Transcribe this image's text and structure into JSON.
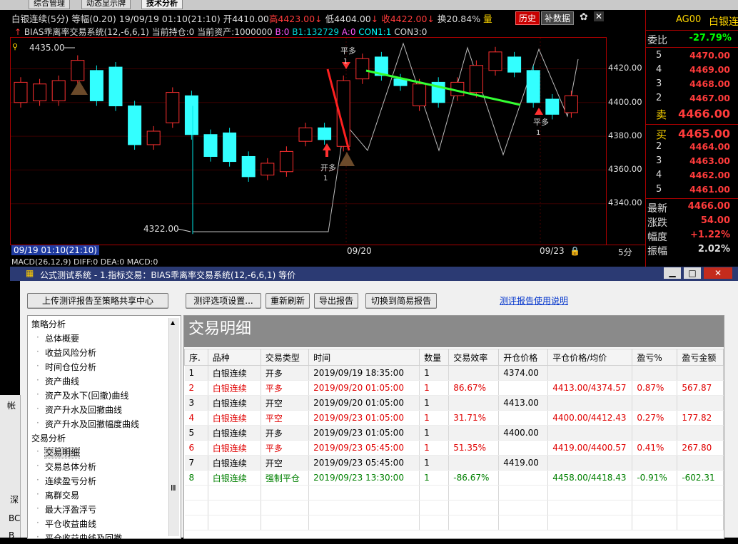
{
  "top_tabs": [
    "综合管理",
    "动态显示牌",
    "技术分析"
  ],
  "header": {
    "symbol": "白银连续(5分)",
    "equal_width": "等幅(0.20)",
    "datetime": "19/09/19 01:10(21:10)",
    "open": "开4410.00",
    "high": "高4423.00",
    "low": "低4404.00",
    "close": "收4422.00",
    "turnover": "换20.84%",
    "volume_prefix": "量",
    "history_btn": "历史",
    "supplement_btn": "补数据",
    "system_name": "BIAS乖离率交易系统(12,-6,6,1)",
    "position": "当前持仓:0",
    "assets": "当前资产:1000000",
    "b0": "B:0",
    "b1": "B1:132729",
    "a0": "A:0",
    "con1": "CON1:1",
    "con3": "CON3:0"
  },
  "chart_data": {
    "type": "candlestick",
    "y_ticks": [
      "4420.00",
      "4400.00",
      "4380.00",
      "4360.00",
      "4340.00"
    ],
    "ylim": [
      4320,
      4435
    ],
    "annotations": {
      "max_label": "4435.00",
      "min_label": "4322.00"
    },
    "x_labels": [
      "09/19 01:10(21:10)",
      "09/20",
      "09/23",
      "5分"
    ],
    "signals": [
      {
        "text": "开多",
        "sub": "1"
      },
      {
        "text": "平多",
        "sub": "1"
      },
      {
        "text": "平多",
        "sub": "1"
      }
    ],
    "candles": [
      {
        "o": 4400,
        "c": 4412
      },
      {
        "o": 4401,
        "c": 4411
      },
      {
        "o": 4401,
        "c": 4413
      },
      {
        "o": 4413,
        "c": 4425
      },
      {
        "o": 4419,
        "c": 4401
      },
      {
        "o": 4421,
        "c": 4398
      },
      {
        "o": 4398,
        "c": 4375
      },
      {
        "o": 4375,
        "c": 4383
      },
      {
        "o": 4388,
        "c": 4406
      },
      {
        "o": 4404,
        "c": 4381
      },
      {
        "o": 4381,
        "c": 4368
      },
      {
        "o": 4382,
        "c": 4365
      },
      {
        "o": 4368,
        "c": 4356
      },
      {
        "o": 4357,
        "c": 4364
      },
      {
        "o": 4359,
        "c": 4371
      },
      {
        "o": 4377,
        "c": 4385
      },
      {
        "o": 4385,
        "c": 4378
      },
      {
        "o": 4374,
        "c": 4413
      },
      {
        "o": 4414,
        "c": 4426
      },
      {
        "o": 4427,
        "c": 4416
      },
      {
        "o": 4414,
        "c": 4410
      },
      {
        "o": 4398,
        "c": 4411
      },
      {
        "o": 4412,
        "c": 4400
      },
      {
        "o": 4404,
        "c": 4412
      },
      {
        "o": 4406,
        "c": 4422
      },
      {
        "o": 4419,
        "c": 4430
      },
      {
        "o": 4427,
        "c": 4418
      },
      {
        "o": 4419,
        "c": 4400
      },
      {
        "o": 4402,
        "c": 4393
      },
      {
        "o": 4394,
        "c": 4404
      }
    ]
  },
  "right_panel": {
    "code": "AG00",
    "name": "白银连",
    "weibi_label": "委比",
    "weibi_value": "-27.79%",
    "sell_rows": [
      {
        "n": "5",
        "price": "4470.00"
      },
      {
        "n": "4",
        "price": "4469.00"
      },
      {
        "n": "3",
        "price": "4468.00"
      },
      {
        "n": "2",
        "price": "4467.00"
      },
      {
        "n": "卖",
        "price": "4466.00"
      }
    ],
    "buy_rows": [
      {
        "n": "买",
        "price": "4465.00"
      },
      {
        "n": "2",
        "price": "4464.00"
      },
      {
        "n": "3",
        "price": "4463.00"
      },
      {
        "n": "4",
        "price": "4462.00"
      },
      {
        "n": "5",
        "price": "4461.00"
      }
    ],
    "stats": [
      {
        "label": "最新",
        "value": "4466.00"
      },
      {
        "label": "涨跌",
        "value": "54.00"
      },
      {
        "label": "幅度",
        "value": "+1.22%"
      },
      {
        "label": "振幅",
        "value": "2.02%"
      }
    ]
  },
  "macd_line": "MACD(26,12,9)  DIFF:0  DEA:0  MACD:0",
  "dialog": {
    "title": "公式测试系统 - 1.指标交易：BIAS乖离率交易系统(12,-6,6,1) 等价",
    "buttons": {
      "upload": "上传测评报告至策略共享中心",
      "settings": "测评选项设置...",
      "refresh": "重新刷新",
      "export": "导出报告",
      "switch": "切换到简易报告",
      "help_link": "测评报告使用说明"
    },
    "tree": [
      {
        "label": "策略分析",
        "level": 0
      },
      {
        "label": "总体概要",
        "level": 1
      },
      {
        "label": "收益风险分析",
        "level": 1
      },
      {
        "label": "时间仓位分析",
        "level": 1
      },
      {
        "label": "资产曲线",
        "level": 1
      },
      {
        "label": "资产及水下(回撤)曲线",
        "level": 1
      },
      {
        "label": "资产升水及回撤曲线",
        "level": 1
      },
      {
        "label": "资产升水及回撤幅度曲线",
        "level": 1
      },
      {
        "label": "交易分析",
        "level": 0
      },
      {
        "label": "交易明细",
        "level": 1,
        "selected": true
      },
      {
        "label": "交易总体分析",
        "level": 1
      },
      {
        "label": "连续盈亏分析",
        "level": 1
      },
      {
        "label": "离群交易",
        "level": 1
      },
      {
        "label": "最大浮盈浮亏",
        "level": 1
      },
      {
        "label": "平仓收益曲线",
        "level": 1
      },
      {
        "label": "平仓收益曲线及回撤",
        "level": 1
      }
    ],
    "grid_title": "交易明细",
    "columns": [
      "序.",
      "品种",
      "交易类型",
      "时间",
      "数量",
      "交易效率",
      "开仓价格",
      "平仓价格/均价",
      "盈亏%",
      "盈亏金额"
    ],
    "rows": [
      {
        "cells": [
          "1",
          "白银连续",
          "开多",
          "2019/09/19 18:35:00",
          "1",
          "",
          "4374.00",
          "",
          "",
          ""
        ],
        "color": "#000000"
      },
      {
        "cells": [
          "2",
          "白银连续",
          "平多",
          "2019/09/20 01:05:00",
          "1",
          "86.67%",
          "",
          "4413.00/4374.57",
          "0.87%",
          "567.87"
        ],
        "color": "#e00000"
      },
      {
        "cells": [
          "3",
          "白银连续",
          "开空",
          "2019/09/20 01:05:00",
          "1",
          "",
          "4413.00",
          "",
          "",
          ""
        ],
        "color": "#000000"
      },
      {
        "cells": [
          "4",
          "白银连续",
          "平空",
          "2019/09/23 01:05:00",
          "1",
          "31.71%",
          "",
          "4400.00/4412.43",
          "0.27%",
          "177.82"
        ],
        "color": "#e00000"
      },
      {
        "cells": [
          "5",
          "白银连续",
          "开多",
          "2019/09/23 01:05:00",
          "1",
          "",
          "4400.00",
          "",
          "",
          ""
        ],
        "color": "#000000"
      },
      {
        "cells": [
          "6",
          "白银连续",
          "平多",
          "2019/09/23 05:45:00",
          "1",
          "51.35%",
          "",
          "4419.00/4400.57",
          "0.41%",
          "267.80"
        ],
        "color": "#e00000"
      },
      {
        "cells": [
          "7",
          "白银连续",
          "开空",
          "2019/09/23 05:45:00",
          "1",
          "",
          "4419.00",
          "",
          "",
          ""
        ],
        "color": "#000000"
      },
      {
        "cells": [
          "8",
          "白银连续",
          "强制平仓",
          "2019/09/23 13:30:00",
          "1",
          "-86.67%",
          "",
          "4458.00/4418.43",
          "-0.91%",
          "-602.31"
        ],
        "color": "#008000"
      }
    ]
  },
  "left_strip_text": [
    "帐",
    "深",
    "BC",
    "B"
  ]
}
